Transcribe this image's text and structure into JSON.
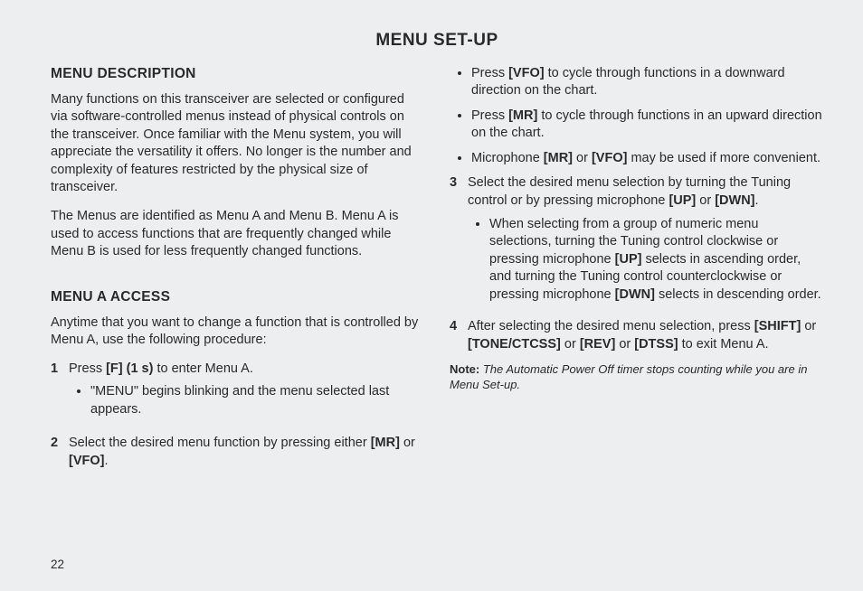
{
  "page_title": "MENU SET-UP",
  "page_number": "22",
  "left": {
    "h_desc": "MENU DESCRIPTION",
    "p_desc_1": "Many functions on this transceiver are selected or configured via software-controlled menus instead of physical controls on the transceiver.  Once familiar with the Menu system, you will appreciate the versatility it offers.  No longer is the number and complexity of features restricted by the physical size of transceiver.",
    "p_desc_2": "The Menus are identified as Menu A and Menu B. Menu A is used to access functions that are frequently changed while Menu B is used for less frequently changed functions.",
    "h_access": "MENU A ACCESS",
    "p_access_intro": "Anytime that you want to change a function that is controlled by Menu A, use the following procedure:",
    "step1_num": "1",
    "step1_pre": "Press ",
    "step1_key": "[F] (1 s)",
    "step1_post": " to enter Menu A.",
    "step1_bullet": "\"MENU\" begins blinking and the menu selected last appears.",
    "step2_num": "2",
    "step2_pre": "Select the desired menu function by pressing either ",
    "step2_keys": "[MR]",
    "step2_or": " or ",
    "step2_key2": "[VFO]",
    "step2_end": "."
  },
  "right": {
    "b_vfo_pre": "Press ",
    "b_vfo_key": "[VFO]",
    "b_vfo_post": " to cycle through functions in a downward direction on the chart.",
    "b_mr_pre": "Press ",
    "b_mr_key": "[MR]",
    "b_mr_post": " to cycle through functions in an upward direction on the chart.",
    "b_mic_pre": "Microphone ",
    "b_mic_k1": "[MR]",
    "b_mic_or": " or ",
    "b_mic_k2": "[VFO]",
    "b_mic_post": " may be used if more convenient.",
    "step3_num": "3",
    "step3_pre": "Select the desired menu selection by turning the Tuning control or by pressing microphone ",
    "step3_k1": "[UP]",
    "step3_or": " or ",
    "step3_k2": "[DWN]",
    "step3_end": ".",
    "step3_b_pre": "When selecting from a group of numeric menu selections, turning the Tuning control clockwise or pressing microphone ",
    "step3_b_k1": "[UP]",
    "step3_b_mid": " selects in ascending order, and turning the Tuning control counterclockwise or pressing microphone ",
    "step3_b_k2": "[DWN]",
    "step3_b_post": " selects in descending order.",
    "step4_num": "4",
    "step4_pre": "After selecting the desired menu selection, press ",
    "step4_k1": "[SHIFT]",
    "step4_or1": " or ",
    "step4_k2": "[TONE/CTCSS]",
    "step4_or2": " or ",
    "step4_k3": "[REV]",
    "step4_or3": " or ",
    "step4_k4": "[DTSS]",
    "step4_post": " to exit Menu A.",
    "note_label": "Note:",
    "note_text": "  The Automatic Power Off timer stops counting while you are in Menu Set-up."
  }
}
